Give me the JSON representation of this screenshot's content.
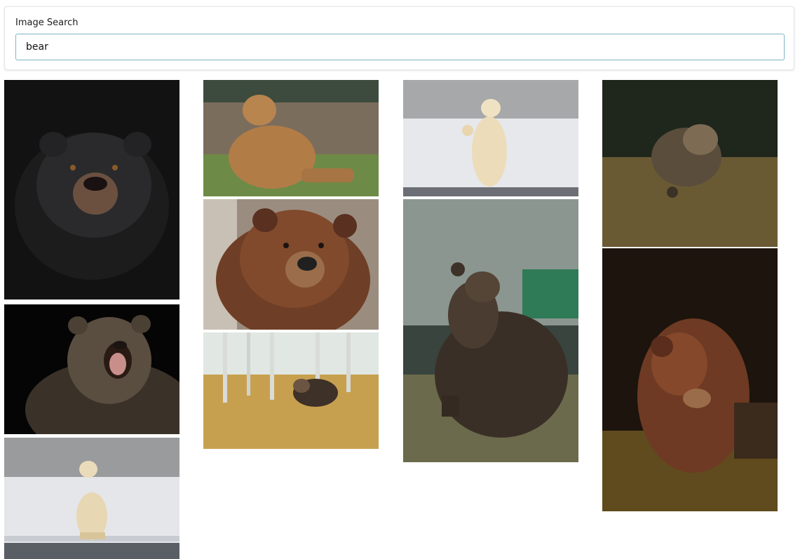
{
  "search": {
    "label": "Image Search",
    "value": "bear"
  },
  "results": [
    {
      "subject": "black-bear-portrait-dark"
    },
    {
      "subject": "grizzly-roaring-dark"
    },
    {
      "subject": "polar-bear-standing-snow"
    },
    {
      "subject": "brown-bear-sitting-grass"
    },
    {
      "subject": "brown-bear-face-closeup"
    },
    {
      "subject": "brown-bear-walking-forest"
    },
    {
      "subject": "polar-bear-waving-snow"
    },
    {
      "subject": "brown-bear-sitting-looking-up"
    },
    {
      "subject": "brown-bear-walking-autumn-grass"
    },
    {
      "subject": "brown-bear-in-dark-forest"
    }
  ]
}
